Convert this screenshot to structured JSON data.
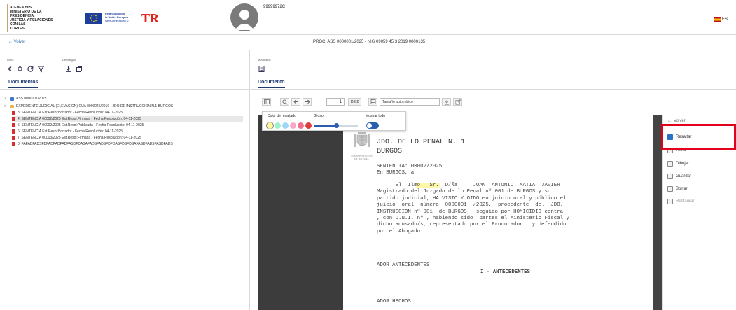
{
  "header": {
    "ministry_lines": [
      "ATENEA HIIS",
      "MINISTERIO DE LA PRESIDENCIA,",
      "JUSTICIA Y RELACIONES CON LAS",
      "CORTES"
    ],
    "eu_text_lines": [
      "Financiado por",
      "la Unión Europea",
      "NextGenerationEU"
    ],
    "prtr_logo": "TR",
    "user_id": "99999972C",
    "language": "ES"
  },
  "subheader": {
    "back_label": "← Volver",
    "proc_title": "PROC. ASS 0000001/2025 - NIG 09059 45 3 2019 0000135"
  },
  "left": {
    "arbol_label": "Árbol",
    "descargas_label": "Descargas",
    "tab_label": "Documentos",
    "tree": [
      {
        "label": "ASS 0000001/2025",
        "type": "folder-blue",
        "caret": "∨"
      },
      {
        "label": "EXPEDIENTE JUDICIAL (ELEVACION) CUA 0000045/2019 - JDO.DE INSTRUCCION N.1 BURGOS",
        "type": "folder",
        "caret": ">"
      },
      {
        "label": "3. SENTENCIA Est.Resol:Borrador - Fecha Resolución: 04-11-2025",
        "type": "pdf"
      },
      {
        "label": "4. SENTENCIA 00002/2025 Est.Resol:Firmada - Fecha Resolución: 04-11-2025",
        "type": "pdf",
        "selected": true
      },
      {
        "label": "5. SENTENCIA 00002/2025 Est.Resol:Publicada - Fecha Resolución: 04-11-2025",
        "type": "pdf"
      },
      {
        "label": "6. SENTENCIA Est.Resol:Borrador - Fecha Resolución: 04-11-2025",
        "type": "pdf"
      },
      {
        "label": "7. SENTENCIA 00003/2025 Est.Resol:Firmada - Fecha Resolución: 04-11-2025",
        "type": "pdf"
      },
      {
        "label": "8. FAFADFADSFDFADFADFADFASDFDASAFADSFADSFDFDASFDSFDSAFASDFADSFASDFADS",
        "type": "pdf"
      }
    ]
  },
  "right": {
    "metadatos_label": "Metadatos",
    "tab_label": "Documento",
    "toolbar": {
      "page_value": "1",
      "page_of": "DE 2",
      "zoom_value": "Tamaño automático"
    },
    "highlight_popup": {
      "color_label": "Color de resaltado",
      "grosor_label": "Grosor",
      "show_all_label": "Mostrar todo",
      "colors": [
        "#fff79a",
        "#9ef0c8",
        "#9fd6f5",
        "#f7a8c8",
        "#f2708a",
        "#e03a3a"
      ],
      "grosor_level": 0.5,
      "show_all": true
    },
    "annot_menu": {
      "back_label": "Volver",
      "items": [
        {
          "label": "Resaltar",
          "state": "active"
        },
        {
          "label": "Texto",
          "state": "normal"
        },
        {
          "label": "Dibujar",
          "state": "normal"
        },
        {
          "label": "Guardar",
          "state": "normal"
        },
        {
          "label": "Borrar",
          "state": "normal"
        },
        {
          "label": "Restaurar",
          "state": "disabled"
        }
      ]
    },
    "document": {
      "admin_caption_1": "ADMINISTRACION",
      "admin_caption_2": "DE JUSTICIA",
      "court_line_1": "JDO. DE LO PENAL N. 1",
      "court_line_2": "BURGOS",
      "sentencia": "SENTENCIA: 00002/2025",
      "en_burgos": "En BURGOS, a  .",
      "body_lines": [
        "      El  Ilmo.  Sr.  D/Ña.    JUAN  ANTONIO  MATIA  JAVIER",
        "Magistrado del Juzgado de lo Penal nº 001 de BURGOS y su",
        "partido judicial, HA VISTO Y OIDO en juicio oral y público el",
        "juicio  oral  número  0000001  /2025,  procedente  del  JDO.",
        "INSTRUCCION nº 001  de BURGOS,  seguido por HOMICIDIO contra",
        ", con D.N.I. nº , habiendo sido  partes el Ministerio Fiscal y",
        "dicho acusado/s, representado por el Procurador   y defendido",
        "por el Abogado  ."
      ],
      "antecedentes_left": "ADOR ANTECEDENTES",
      "antecedentes_title": "I.- ANTECEDENTES",
      "hechos_left": "ADOR HECHOS"
    }
  }
}
